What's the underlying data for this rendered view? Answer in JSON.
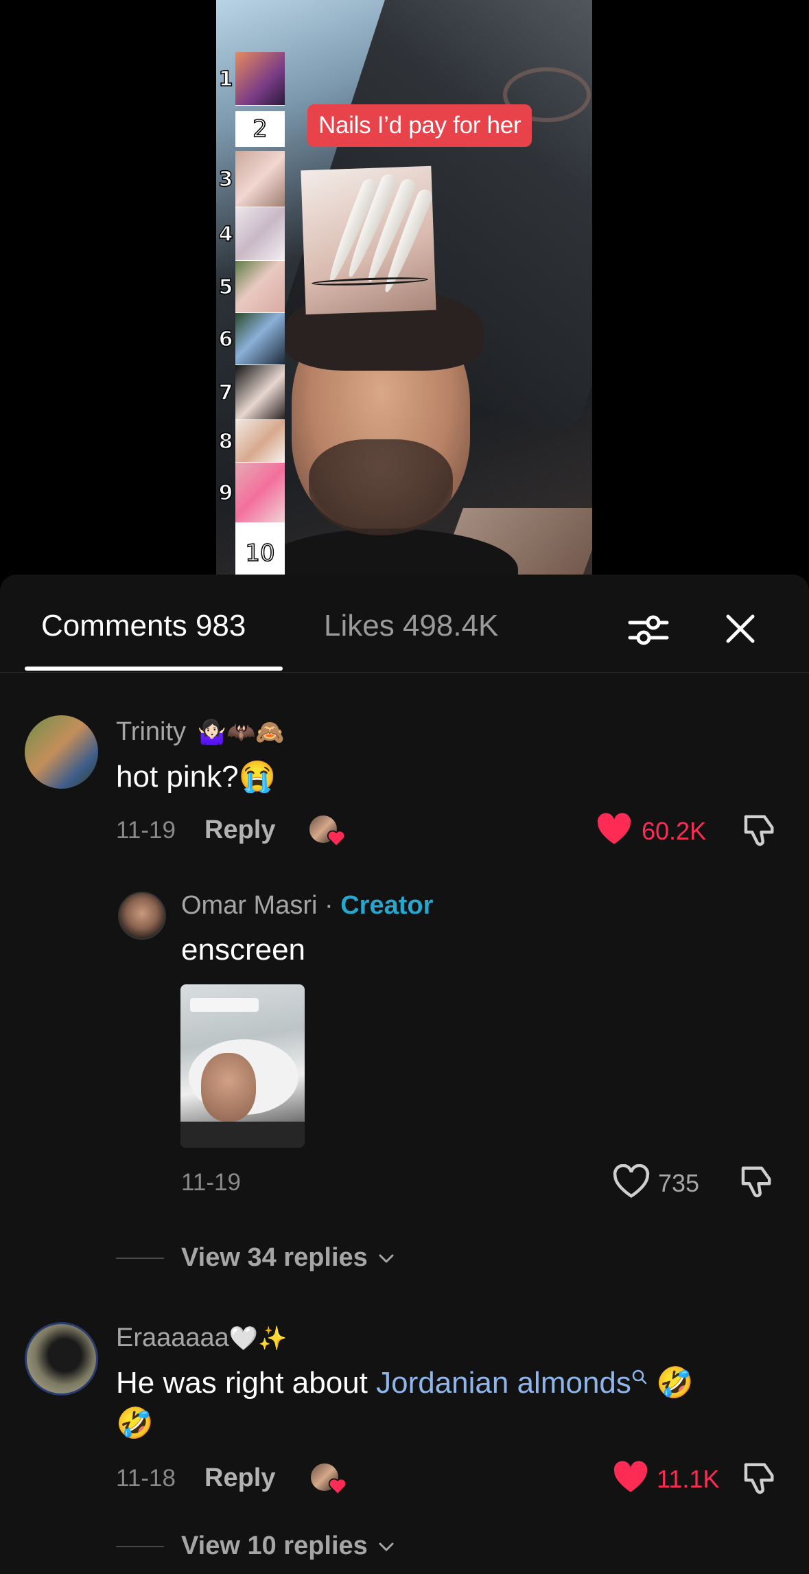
{
  "video": {
    "caption": "Nails I’d pay for her",
    "rank_numbers": [
      "1",
      "2",
      "3",
      "4",
      "5",
      "6",
      "7",
      "8",
      "9",
      "10"
    ]
  },
  "tabs": {
    "comments_label": "Comments 983",
    "likes_label": "Likes 498.4K"
  },
  "comments": [
    {
      "username": "Trinity",
      "username_emoji": "🤷🏻‍♀️🦇🙈",
      "text": "hot pink?😭",
      "date": "11-19",
      "reply_label": "Reply",
      "likes": "60.2K",
      "liked": true,
      "replies": [
        {
          "username": "Omar Masri",
          "separator": " · ",
          "badge": "Creator",
          "text": "enscreen",
          "date": "11-19",
          "likes": "735",
          "liked": false
        }
      ],
      "view_replies_label": "View 34 replies"
    },
    {
      "username": "Eraaaaaa",
      "username_emoji": "🤍✨",
      "text_prefix": "He was right about ",
      "text_link": "Jordanian almonds",
      "text_suffix": " 🤣",
      "text_line2": "🤣",
      "date": "11-18",
      "reply_label": "Reply",
      "likes": "11.1K",
      "liked": true,
      "view_replies_label": "View 10 replies"
    }
  ],
  "colors": {
    "like_red": "#fe2c55",
    "creator_blue": "#25a7d0",
    "link_blue": "#8fb6ea",
    "sheet_bg": "#121212"
  }
}
